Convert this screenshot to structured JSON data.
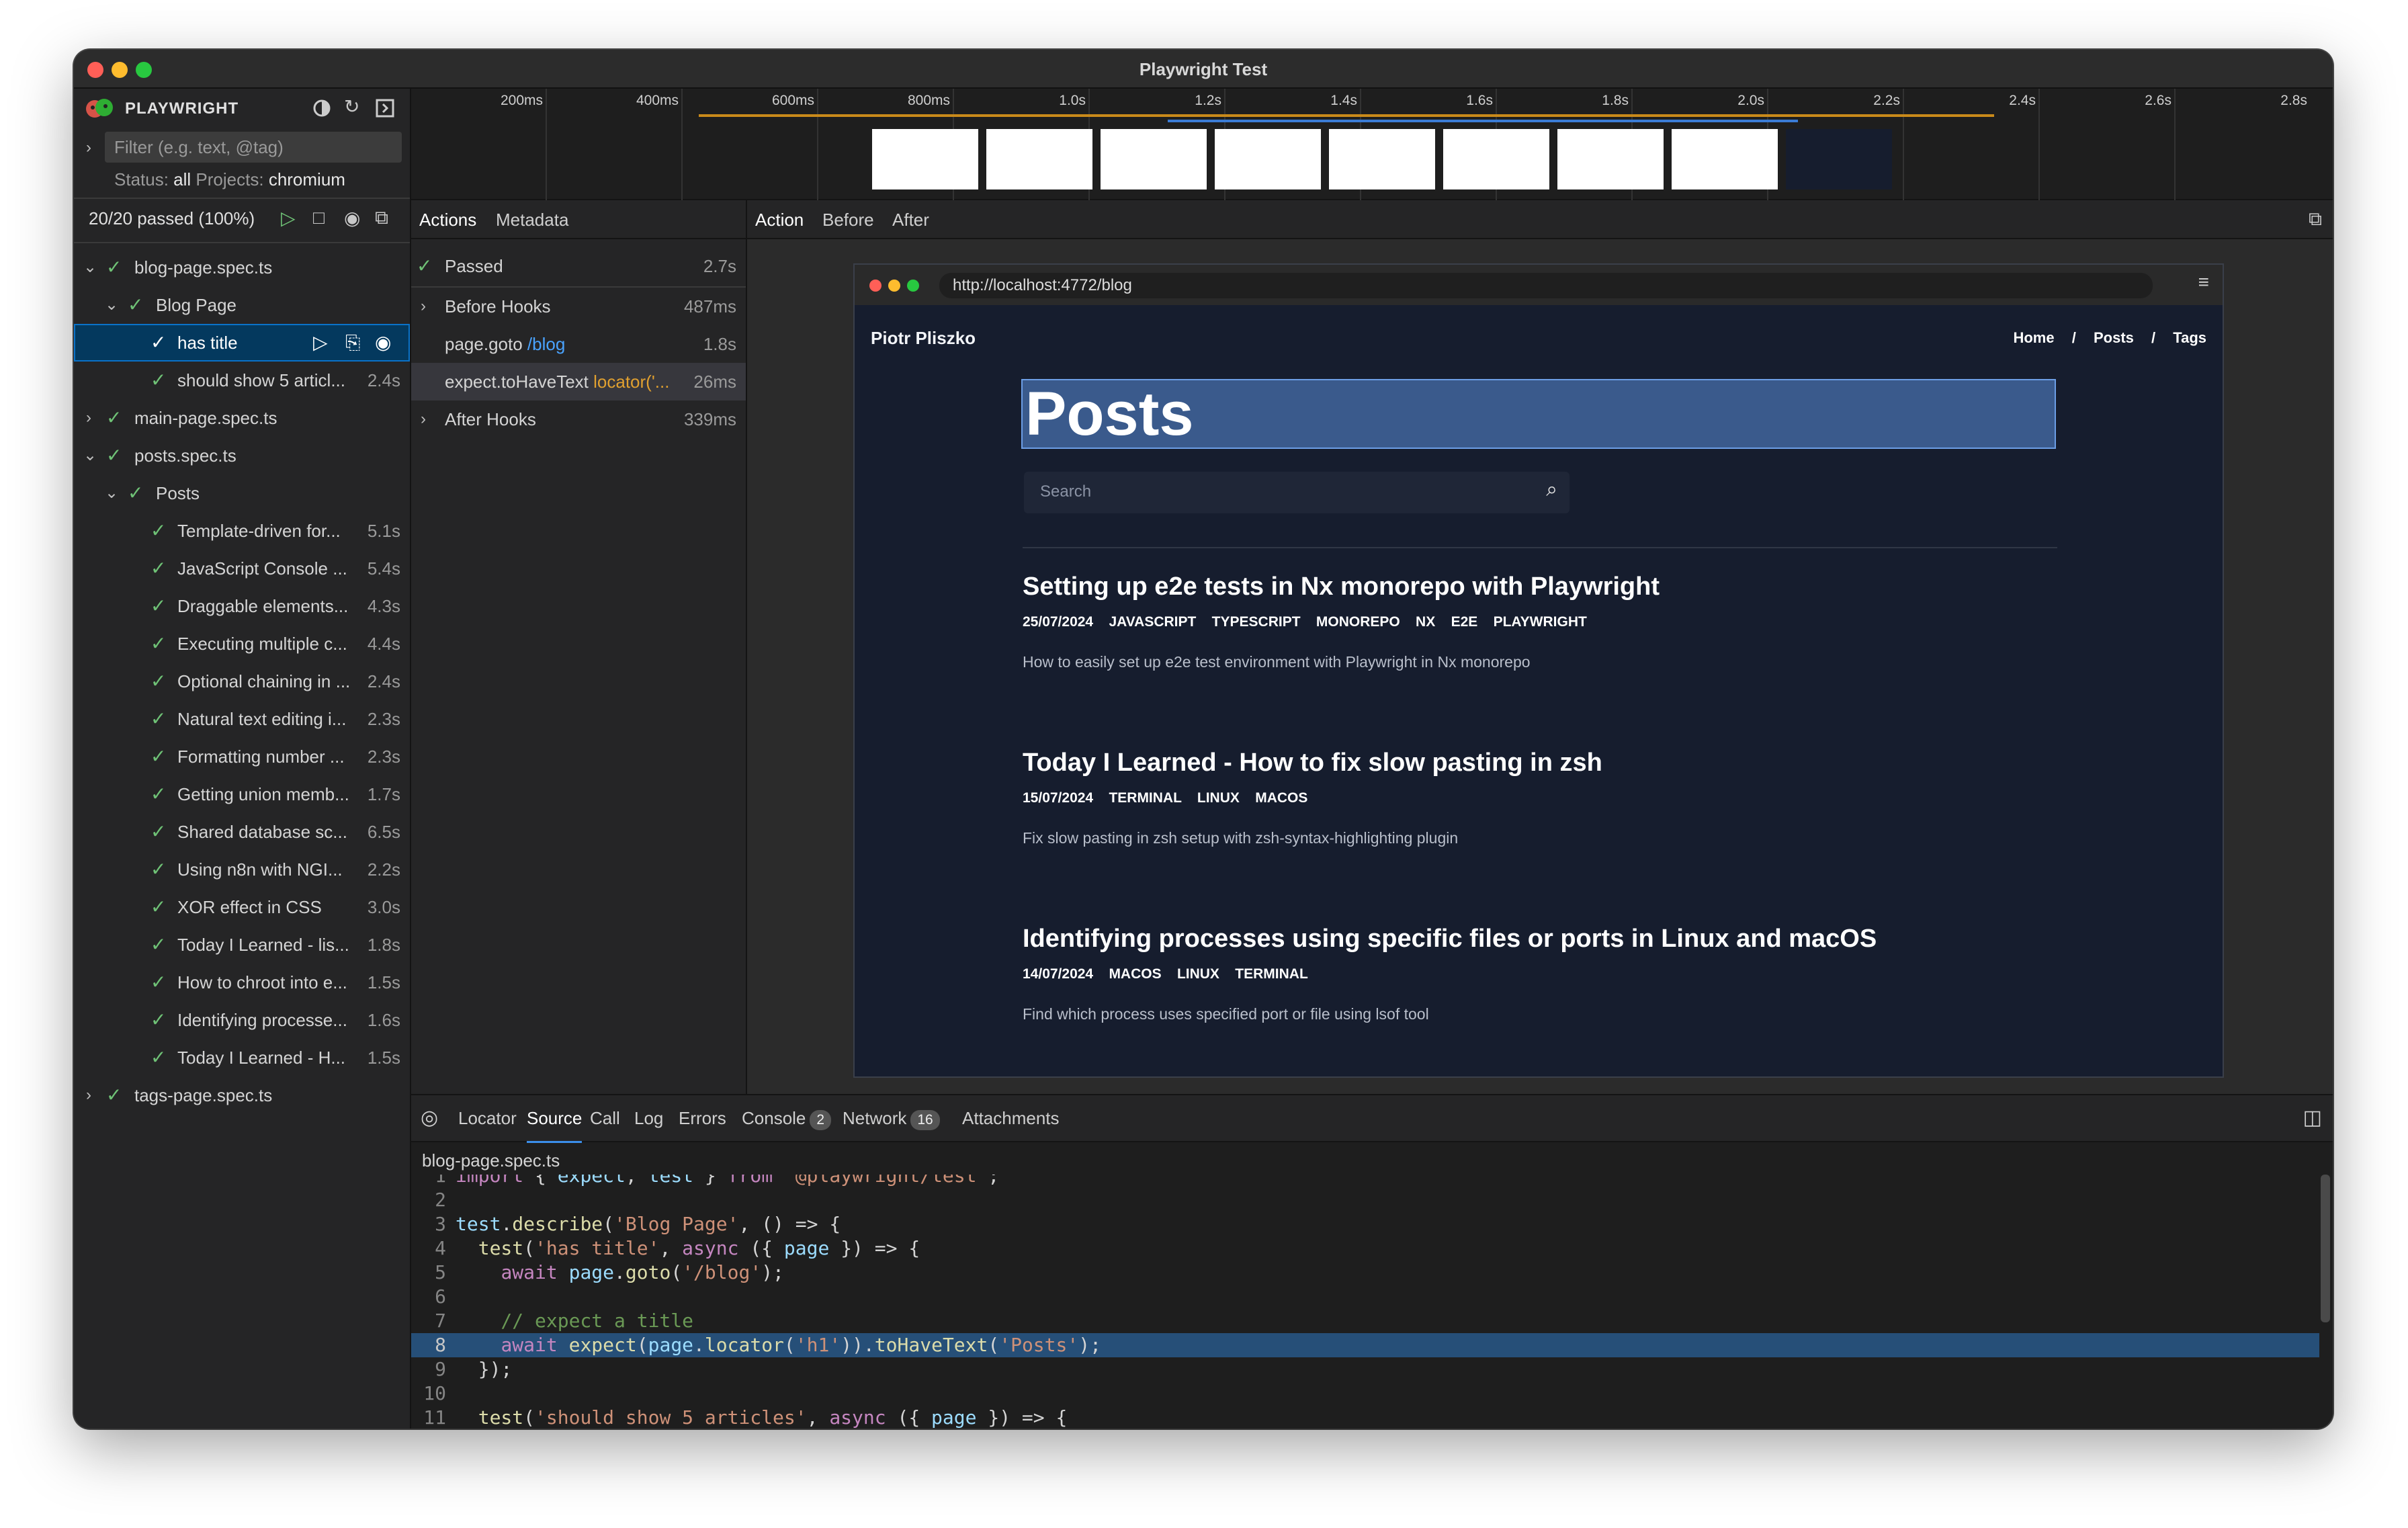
{
  "window": {
    "title": "Playwright Test"
  },
  "sidebar": {
    "brand": "PLAYWRIGHT",
    "filter_placeholder": "Filter (e.g. text, @tag)",
    "status_label": "Status:",
    "status_value": "all",
    "projects_label": "Projects:",
    "projects_value": "chromium",
    "passed_summary": "20/20 passed (100%)",
    "tree": [
      {
        "label": "blog-page.spec.ts",
        "duration": ""
      },
      {
        "label": "Blog Page",
        "duration": ""
      },
      {
        "label": "has title",
        "duration": ""
      },
      {
        "label": "should show 5 articl...",
        "duration": "2.4s"
      },
      {
        "label": "main-page.spec.ts",
        "duration": ""
      },
      {
        "label": "posts.spec.ts",
        "duration": ""
      },
      {
        "label": "Posts",
        "duration": ""
      },
      {
        "label": "Template-driven for...",
        "duration": "5.1s"
      },
      {
        "label": "JavaScript Console ...",
        "duration": "5.4s"
      },
      {
        "label": "Draggable elements...",
        "duration": "4.3s"
      },
      {
        "label": "Executing multiple c...",
        "duration": "4.4s"
      },
      {
        "label": "Optional chaining in ...",
        "duration": "2.4s"
      },
      {
        "label": "Natural text editing i...",
        "duration": "2.3s"
      },
      {
        "label": "Formatting number ...",
        "duration": "2.3s"
      },
      {
        "label": "Getting union memb...",
        "duration": "1.7s"
      },
      {
        "label": "Shared database sc...",
        "duration": "6.5s"
      },
      {
        "label": "Using n8n with NGI...",
        "duration": "2.2s"
      },
      {
        "label": "XOR effect in CSS",
        "duration": "3.0s"
      },
      {
        "label": "Today I Learned - lis...",
        "duration": "1.8s"
      },
      {
        "label": "How to chroot into e...",
        "duration": "1.5s"
      },
      {
        "label": "Identifying processe...",
        "duration": "1.6s"
      },
      {
        "label": "Today I Learned - H...",
        "duration": "1.5s"
      },
      {
        "label": "tags-page.spec.ts",
        "duration": ""
      }
    ]
  },
  "timeline": {
    "ticks": [
      "200ms",
      "400ms",
      "600ms",
      "800ms",
      "1.0s",
      "1.2s",
      "1.4s",
      "1.6s",
      "1.8s",
      "2.0s",
      "2.2s",
      "2.4s",
      "2.6s",
      "2.8s"
    ]
  },
  "actions_panel": {
    "tabs": [
      "Actions",
      "Metadata"
    ],
    "items": [
      {
        "label": "Passed",
        "duration": "2.7s"
      },
      {
        "label": "Before Hooks",
        "duration": "487ms"
      },
      {
        "label": "page.goto",
        "arg": "/blog",
        "duration": "1.8s"
      },
      {
        "label": "expect.toHaveText",
        "arg": "locator('...",
        "duration": "26ms"
      },
      {
        "label": "After Hooks",
        "duration": "339ms"
      }
    ]
  },
  "viewer": {
    "tabs": [
      "Action",
      "Before",
      "After"
    ],
    "url": "http://localhost:4772/blog",
    "site": {
      "author": "Piotr Pliszko",
      "nav": [
        "Home",
        "/",
        "Posts",
        "/",
        "Tags"
      ],
      "heading": "Posts",
      "search_placeholder": "Search",
      "posts": [
        {
          "title": "Setting up e2e tests in Nx monorepo with Playwright",
          "meta": "25/07/2024    JAVASCRIPT    TYPESCRIPT    MONOREPO    NX    E2E    PLAYWRIGHT",
          "desc": "How to easily set up e2e test environment with Playwright in Nx monorepo"
        },
        {
          "title": "Today I Learned - How to fix slow pasting in zsh",
          "meta": "15/07/2024    TERMINAL    LINUX    MACOS",
          "desc": "Fix slow pasting in zsh setup with zsh-syntax-highlighting plugin"
        },
        {
          "title": "Identifying processes using specific files or ports in Linux and macOS",
          "meta": "14/07/2024    MACOS    LINUX    TERMINAL",
          "desc": "Find which process uses specified port or file using lsof tool"
        }
      ]
    }
  },
  "bottom": {
    "tabs": [
      "Locator",
      "Source",
      "Call",
      "Log",
      "Errors",
      "Console",
      "Network",
      "Attachments"
    ],
    "console_count": "2",
    "network_count": "16",
    "file": "blog-page.spec.ts",
    "code": [
      {
        "n": "1",
        "t": "import { expect, test } from '@playwright/test';"
      },
      {
        "n": "2",
        "t": ""
      },
      {
        "n": "3",
        "t": "test.describe('Blog Page', () => {"
      },
      {
        "n": "4",
        "t": "  test('has title', async ({ page }) => {"
      },
      {
        "n": "5",
        "t": "    await page.goto('/blog');"
      },
      {
        "n": "6",
        "t": ""
      },
      {
        "n": "7",
        "t": "    // expect a title"
      },
      {
        "n": "8",
        "t": "    await expect(page.locator('h1')).toHaveText('Posts');"
      },
      {
        "n": "9",
        "t": "  });"
      },
      {
        "n": "10",
        "t": ""
      },
      {
        "n": "11",
        "t": "  test('should show 5 articles', async ({ page }) => {"
      }
    ]
  }
}
